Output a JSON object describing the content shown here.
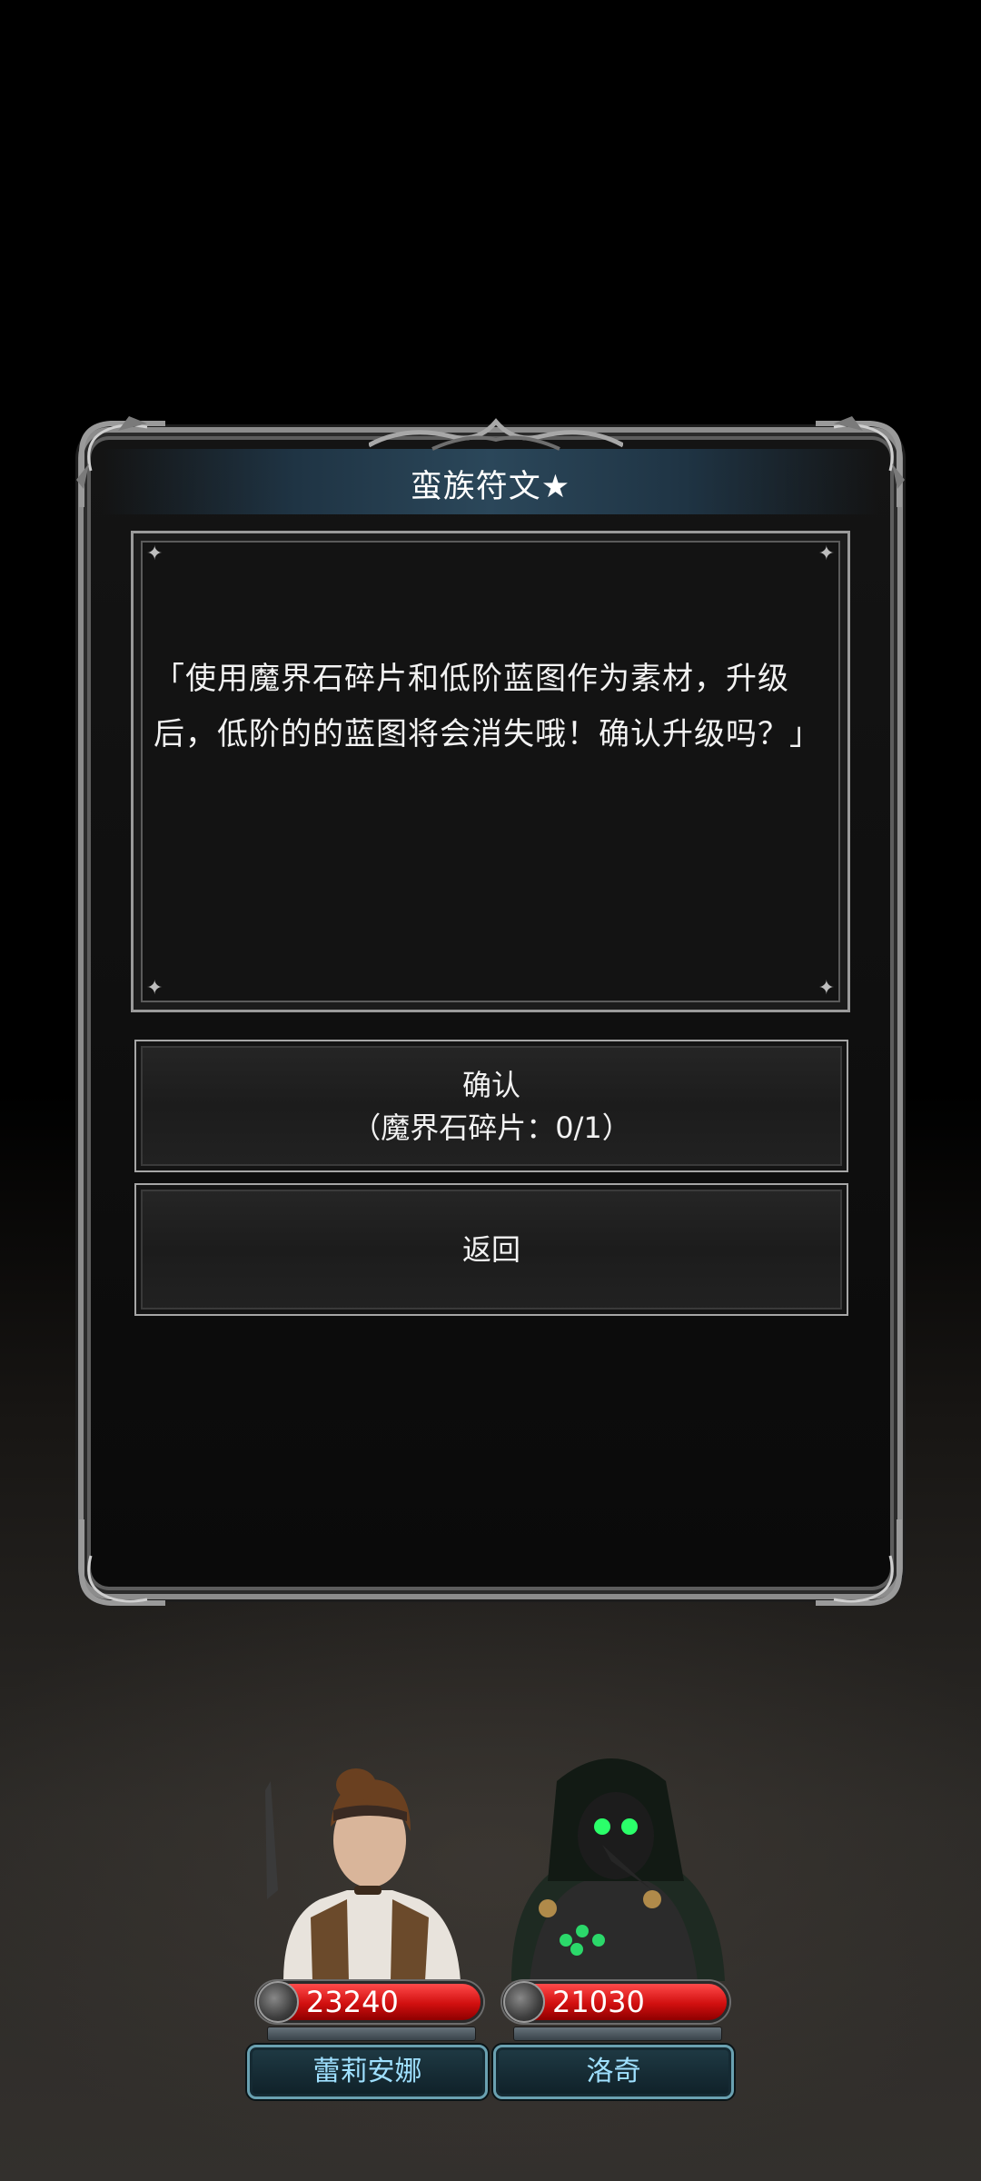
{
  "dialog": {
    "title": "蛮族符文★",
    "message": "「使用魔界石碎片和低阶蓝图作为素材，升级后，低阶的的蓝图将会消失哦！确认升级吗？」",
    "confirm_label": "确认",
    "confirm_cost": "（魔界石碎片：0/1）",
    "back_label": "返回"
  },
  "party": [
    {
      "name": "蕾莉安娜",
      "hp": "23240"
    },
    {
      "name": "洛奇",
      "hp": "21030"
    }
  ],
  "colors": {
    "hp_bar": "#d10f0f",
    "name_text": "#9fe0ff",
    "frame": "#8c8c8c"
  }
}
